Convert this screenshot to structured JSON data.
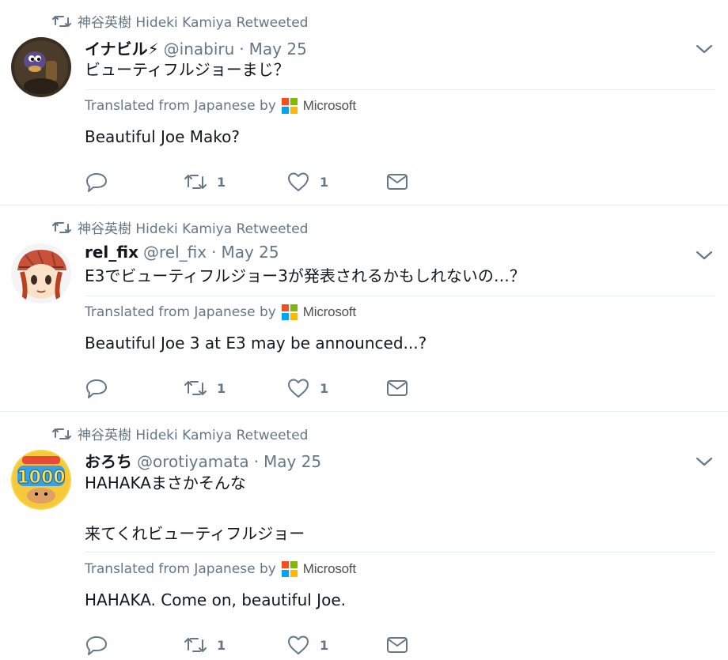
{
  "tweets": [
    {
      "retweeted_by": "神谷英樹 Hideki Kamiya Retweeted",
      "name": "イナビル⚡",
      "handle": "@inabiru",
      "separator": "·",
      "date": "May 25",
      "text": "ビューティフルジョーまじ？",
      "translated_label": "Translated from Japanese by",
      "translator": "Microsoft",
      "translation": "Beautiful Joe Mako?",
      "retweets": "1",
      "likes": "1"
    },
    {
      "retweeted_by": "神谷英樹 Hideki Kamiya Retweeted",
      "name": "rel_fix",
      "handle": "@rel_fix",
      "separator": "·",
      "date": "May 25",
      "text": "E3でビューティフルジョー3が発表されるかもしれないの…？",
      "translated_label": "Translated from Japanese by",
      "translator": "Microsoft",
      "translation": "Beautiful Joe 3 at E3 may be announced...?",
      "retweets": "1",
      "likes": "1"
    },
    {
      "retweeted_by": "神谷英樹 Hideki Kamiya Retweeted",
      "name": "おろち",
      "handle": "@orotiyamata",
      "separator": "·",
      "date": "May 25",
      "text": "HAHAKAまさかそんな\n\n来てくれビューティフルジョー",
      "translated_label": "Translated from Japanese by",
      "translator": "Microsoft",
      "translation": "HAHAKA. Come on, beautiful Joe.",
      "retweets": "1",
      "likes": "1"
    }
  ],
  "colors": {
    "secondary_text": "#657786",
    "divider": "#e6ecf0",
    "ms_red": "#f25022",
    "ms_green": "#7fba00",
    "ms_blue": "#00a4ef",
    "ms_yellow": "#ffb900"
  }
}
